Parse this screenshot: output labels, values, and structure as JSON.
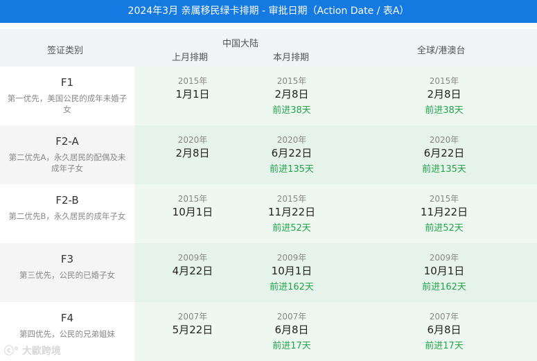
{
  "title": "2024年3月 亲属移民绿卡排期 - 审批日期（Action Date / 表A）",
  "header": {
    "category_label": "签证类别",
    "china_label": "中国大陆",
    "last_month_label": "上月排期",
    "this_month_label": "本月排期",
    "global_label": "全球/港澳台"
  },
  "rows": [
    {
      "code": "F1",
      "desc": "第一优先，美国公民的成年未婚子女",
      "last": {
        "year": "2015年",
        "date": "1月1日"
      },
      "cur": {
        "year": "2015年",
        "date": "2月8日",
        "adv": "前进38天"
      },
      "global": {
        "year": "2015年",
        "date": "2月8日",
        "adv": "前进38天"
      }
    },
    {
      "code": "F2-A",
      "desc": "第二优先A，永久居民的配偶及未成年子女",
      "last": {
        "year": "2020年",
        "date": "2月8日"
      },
      "cur": {
        "year": "2020年",
        "date": "6月22日",
        "adv": "前进135天"
      },
      "global": {
        "year": "2020年",
        "date": "6月22日",
        "adv": "前进135天"
      }
    },
    {
      "code": "F2-B",
      "desc": "第二优先B，永久居民的成年子女",
      "last": {
        "year": "2015年",
        "date": "10月1日"
      },
      "cur": {
        "year": "2015年",
        "date": "11月22日",
        "adv": "前进52天"
      },
      "global": {
        "year": "2015年",
        "date": "11月22日",
        "adv": "前进52天"
      }
    },
    {
      "code": "F3",
      "desc": "第三优先，公民的已婚子女",
      "last": {
        "year": "2009年",
        "date": "4月22日"
      },
      "cur": {
        "year": "2009年",
        "date": "10月1日",
        "adv": "前进162天"
      },
      "global": {
        "year": "2009年",
        "date": "10月1日",
        "adv": "前进162天"
      }
    },
    {
      "code": "F4",
      "desc": "第四优先，公民的兄弟姐妹",
      "last": {
        "year": "2007年",
        "date": "5月22日"
      },
      "cur": {
        "year": "2007年",
        "date": "6月8日",
        "adv": "前进17天"
      },
      "global": {
        "year": "2007年",
        "date": "6月8日",
        "adv": "前进17天"
      }
    }
  ],
  "watermark": "大歐跨境",
  "colors": {
    "banner": "#1479e0",
    "advance": "#22a34a",
    "row_light": "#ffffff",
    "row_dark": "#f5f5f5",
    "cell_light": "#eef8f1",
    "cell_dark": "#e6f3ea"
  }
}
